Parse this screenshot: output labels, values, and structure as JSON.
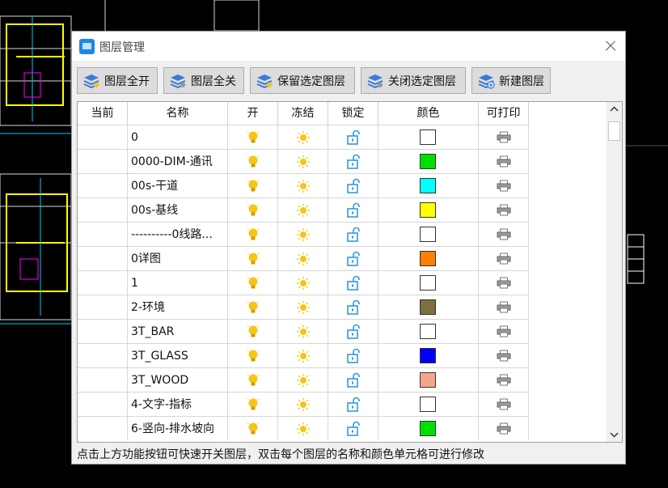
{
  "window": {
    "title": "图层管理"
  },
  "toolbar": [
    {
      "label": "图层全开",
      "icon": "layers-on-icon"
    },
    {
      "label": "图层全关",
      "icon": "layers-off-icon"
    },
    {
      "label": "保留选定图层",
      "icon": "layers-keep-icon"
    },
    {
      "label": "关闭选定图层",
      "icon": "layers-close-icon"
    },
    {
      "label": "新建图层",
      "icon": "layers-new-icon"
    }
  ],
  "table": {
    "headers": [
      "当前",
      "名称",
      "开",
      "冻结",
      "锁定",
      "颜色",
      "可打印"
    ],
    "rows": [
      {
        "name": "0",
        "color": "#ffffff"
      },
      {
        "name": "0000-DIM-通讯",
        "color": "#00e000"
      },
      {
        "name": "00s-干道",
        "color": "#00ffff"
      },
      {
        "name": "00s-基线",
        "color": "#ffff00"
      },
      {
        "name": "----------0线路...",
        "color": "#ffffff"
      },
      {
        "name": "0详图",
        "color": "#ff7f00"
      },
      {
        "name": "1",
        "color": "#ffffff"
      },
      {
        "name": "2-环境",
        "color": "#7f6f3f"
      },
      {
        "name": "3T_BAR",
        "color": "#ffffff"
      },
      {
        "name": "3T_GLASS",
        "color": "#0000ff"
      },
      {
        "name": "3T_WOOD",
        "color": "#f5a58a"
      },
      {
        "name": "4-文字-指标",
        "color": "#ffffff"
      },
      {
        "name": "6-竖向-排水坡向",
        "color": "#00e000"
      }
    ]
  },
  "status": {
    "hint": "点击上方功能按钮可快速开关图层，双击每个图层的名称和颜色单元格可进行修改"
  },
  "colors": {
    "accent": "#1e88e5",
    "bulb": "#f5c518",
    "sun": "#f5c518",
    "lock": "#3399dd"
  }
}
